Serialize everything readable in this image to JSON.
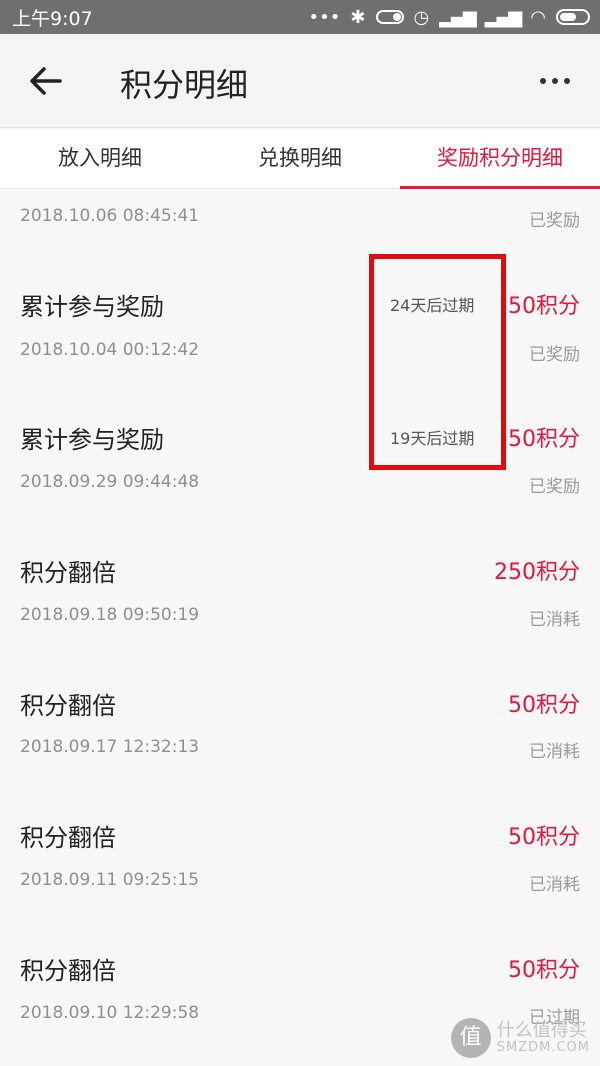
{
  "status_bar": {
    "time": "上午9:07",
    "icons": [
      "dots-icon",
      "bluetooth-icon",
      "toggle-icon",
      "alarm-icon",
      "signal-icon",
      "signal-icon",
      "wifi-icon",
      "battery-icon"
    ]
  },
  "app_bar": {
    "title": "积分明细"
  },
  "tabs": [
    {
      "label": "放入明细",
      "active": false
    },
    {
      "label": "兑换明细",
      "active": false
    },
    {
      "label": "奖励积分明细",
      "active": true
    }
  ],
  "records": [
    {
      "title": "",
      "points": "",
      "expire": "",
      "time": "2018.10.06 08:45:41",
      "state": "已奖励"
    },
    {
      "title": "累计参与奖励",
      "points": "50积分",
      "expire": "24天后过期",
      "time": "2018.10.04 00:12:42",
      "state": "已奖励"
    },
    {
      "title": "累计参与奖励",
      "points": "50积分",
      "expire": "19天后过期",
      "time": "2018.09.29 09:44:48",
      "state": "已奖励"
    },
    {
      "title": "积分翻倍",
      "points": "250积分",
      "expire": "",
      "time": "2018.09.18 09:50:19",
      "state": "已消耗"
    },
    {
      "title": "积分翻倍",
      "points": "50积分",
      "expire": "",
      "time": "2018.09.17 12:32:13",
      "state": "已消耗"
    },
    {
      "title": "积分翻倍",
      "points": "50积分",
      "expire": "",
      "time": "2018.09.11 09:25:15",
      "state": "已消耗"
    },
    {
      "title": "积分翻倍",
      "points": "50积分",
      "expire": "",
      "time": "2018.09.10 12:29:58",
      "state": "已过期"
    }
  ],
  "watermark": {
    "logo": "值",
    "cn": "什么值得买",
    "en": "SMZDM.COM"
  },
  "colors": {
    "accent": "#e6163c",
    "highlight": "#e6080f"
  }
}
